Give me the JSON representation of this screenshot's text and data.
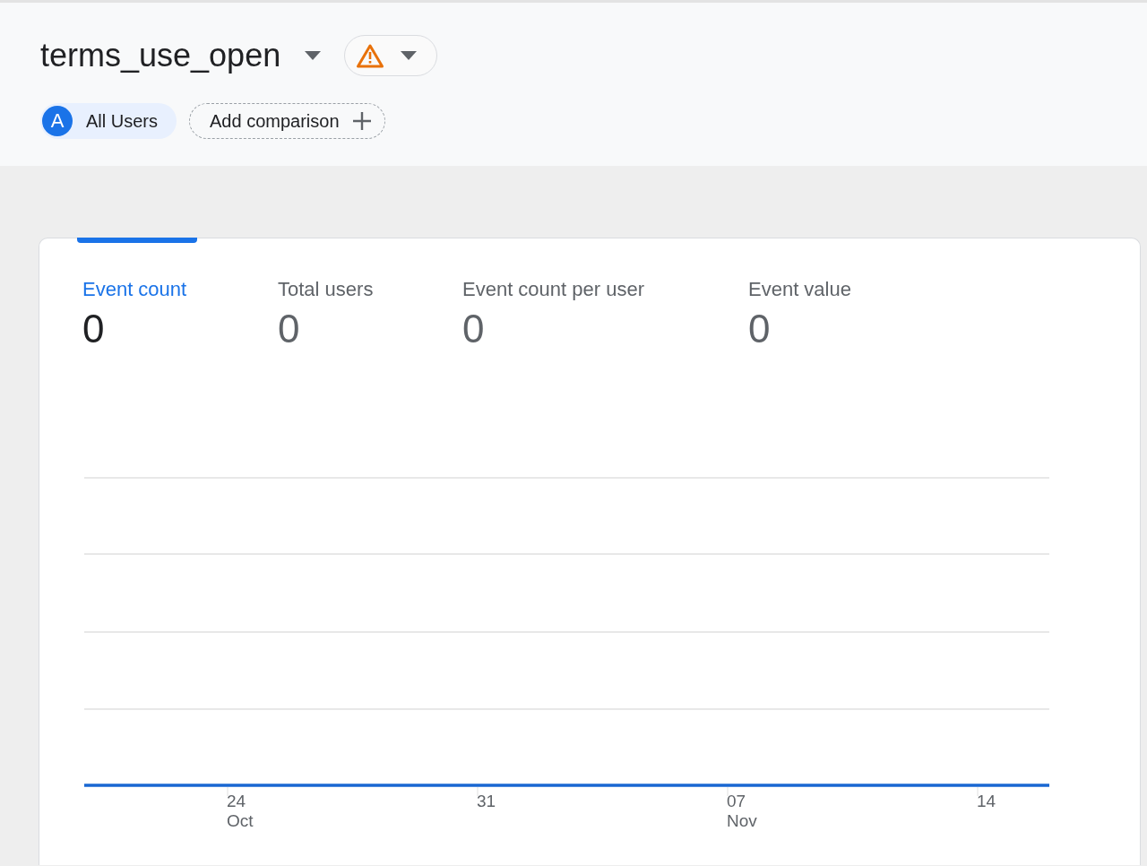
{
  "header": {
    "title": "terms_use_open",
    "segments": [
      {
        "badge": "A",
        "label": "All Users"
      }
    ],
    "add_comparison": "Add comparison"
  },
  "card": {
    "metrics": [
      {
        "label": "Event count",
        "value": "0",
        "selected": true
      },
      {
        "label": "Total users",
        "value": "0",
        "selected": false
      },
      {
        "label": "Event count per user",
        "value": "0",
        "selected": false
      },
      {
        "label": "Event value",
        "value": "0",
        "selected": false
      }
    ],
    "chart_x_labels": [
      {
        "day": "24",
        "month": "Oct"
      },
      {
        "day": "31"
      },
      {
        "day": "07",
        "month": "Nov"
      },
      {
        "day": "14"
      }
    ]
  }
}
